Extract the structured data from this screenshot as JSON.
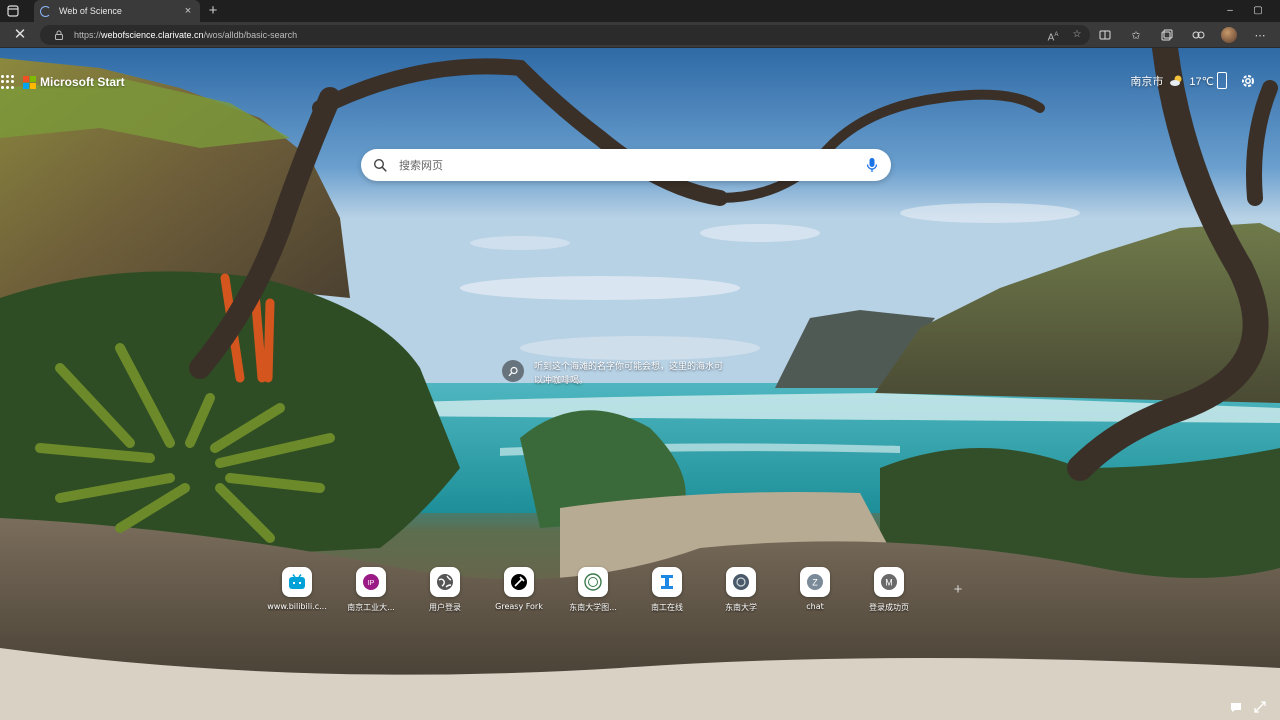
{
  "browser": {
    "tab": {
      "title": "Web of Science",
      "close_glyph": "×"
    },
    "new_tab_glyph": "+",
    "window_controls": {
      "minimize": "–",
      "maximize": "▢",
      "close": "✕"
    },
    "stop_glyph": "✕",
    "url": {
      "prefix": "https://",
      "domain": "webofscience.clarivate.cn",
      "path": "/wos/alldb/basic-search"
    },
    "url_actions": [
      "read-aloud-icon",
      "favorite-star-icon"
    ],
    "toolbar_icons": [
      "split-screen-icon",
      "favorites-icon",
      "collections-icon",
      "extensions-icon",
      "profile-avatar",
      "more-icon"
    ]
  },
  "newtab": {
    "brand": "Microsoft Start",
    "ms_logo_colors": [
      "#f25022",
      "#7fba00",
      "#00a4ef",
      "#ffb900"
    ],
    "weather": {
      "city": "南京市",
      "temp": "17℃",
      "icon": "partly-cloudy-icon"
    },
    "search": {
      "placeholder": "搜索网页"
    },
    "background_info": {
      "text": "听到这个海滩的名字你可能会想，这里的海水可以冲咖啡喝。"
    },
    "quick_links": [
      {
        "label": "www.bilibili.c...",
        "icon": "bilibili-icon",
        "color": "#00a1d6"
      },
      {
        "label": "南京工业大...",
        "icon": "njtech-icon",
        "color": "#9b1b86"
      },
      {
        "label": "用户登录",
        "icon": "globe-icon",
        "color": "#555555"
      },
      {
        "label": "Greasy Fork",
        "icon": "greasyfork-icon",
        "color": "#000000"
      },
      {
        "label": "东南大学图...",
        "icon": "seu-library-icon",
        "color": "#3a7a4a"
      },
      {
        "label": "南工在线",
        "icon": "njtech-online-icon",
        "color": "#1e88e5"
      },
      {
        "label": "东南大学",
        "icon": "seu-icon",
        "color": "#4a5a6a"
      },
      {
        "label": "chat",
        "icon": "chat-z-icon",
        "color": "#7a8a99"
      },
      {
        "label": "登录成功页",
        "icon": "login-m-icon",
        "color": "#6a6a6a"
      }
    ],
    "add_link_glyph": "+"
  }
}
